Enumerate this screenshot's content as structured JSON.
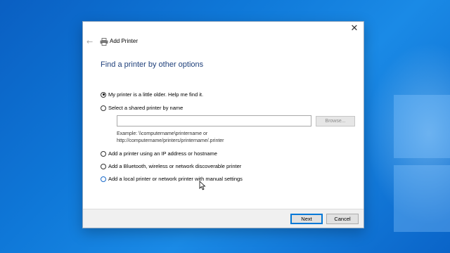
{
  "window": {
    "title": "Add Printer",
    "heading": "Find a printer by other options",
    "close_glyph": "✕",
    "back_glyph": "←"
  },
  "options": [
    {
      "label": "My printer is a little older. Help me find it.",
      "checked": true
    },
    {
      "label": "Select a shared printer by name",
      "checked": false
    },
    {
      "label": "Add a printer using an IP address or hostname",
      "checked": false
    },
    {
      "label": "Add a Bluetooth, wireless or network discoverable printer",
      "checked": false
    },
    {
      "label": "Add a local printer or network printer with manual settings",
      "checked": false
    }
  ],
  "shared": {
    "input_value": "",
    "browse_label": "Browse...",
    "example_line1": "Example: \\\\computername\\printername or",
    "example_line2": "http://computername/printers/printername/.printer"
  },
  "footer": {
    "next_label": "Next",
    "cancel_label": "Cancel"
  },
  "icons": {
    "back": "back-arrow-icon",
    "close": "close-icon",
    "printer": "printer-icon"
  },
  "colors": {
    "heading": "#1e3f7a",
    "accent": "#0078d7"
  }
}
